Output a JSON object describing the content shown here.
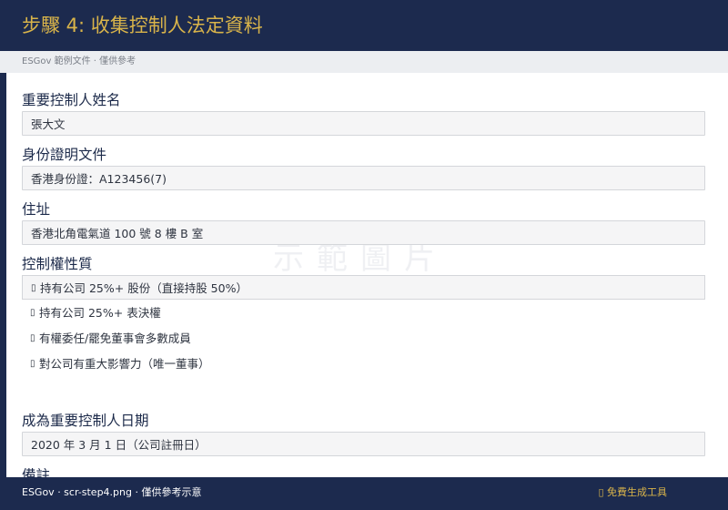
{
  "header": {
    "title": "步驟 4: 收集控制人法定資料"
  },
  "subbar": {
    "text": "ESGov 範例文件 · 僅供參考"
  },
  "watermark": {
    "text": "示範圖片"
  },
  "form": {
    "name_label": "重要控制人姓名",
    "name_value": "張大文",
    "id_label": "身份證明文件",
    "id_value": "香港身份證：A123456(7)",
    "address_label": "住址",
    "address_value": "香港北角電氣道 100 號 8 樓 B 室",
    "control_label": "控制權性質",
    "control_options": [
      {
        "icon": "checkbox-icon",
        "glyph": "▯",
        "label": "持有公司 25%+ 股份（直接持股 50%）",
        "selected": true
      },
      {
        "icon": "checkbox-icon",
        "glyph": "▯",
        "label": "持有公司 25%+ 表決權",
        "selected": false
      },
      {
        "icon": "checkbox-icon",
        "glyph": "▯",
        "label": "有權委任/罷免董事會多數成員",
        "selected": false
      },
      {
        "icon": "checkbox-icon",
        "glyph": "▯",
        "label": "對公司有重大影響力（唯一董事）",
        "selected": false
      }
    ],
    "date_label": "成為重要控制人日期",
    "date_value": "2020 年 3 月 1 日（公司註冊日）",
    "remarks_label": "備註"
  },
  "footer": {
    "left_text": "ESGov · scr-step4.png · 僅供參考示意",
    "right_icon": "tool-icon",
    "right_glyph": "▯",
    "right_text": "免費生成工具"
  },
  "colors": {
    "navy": "#1c2a4e",
    "gold": "#d9b44a",
    "field_bg": "#f5f5f6",
    "field_border": "#d4d6da"
  }
}
